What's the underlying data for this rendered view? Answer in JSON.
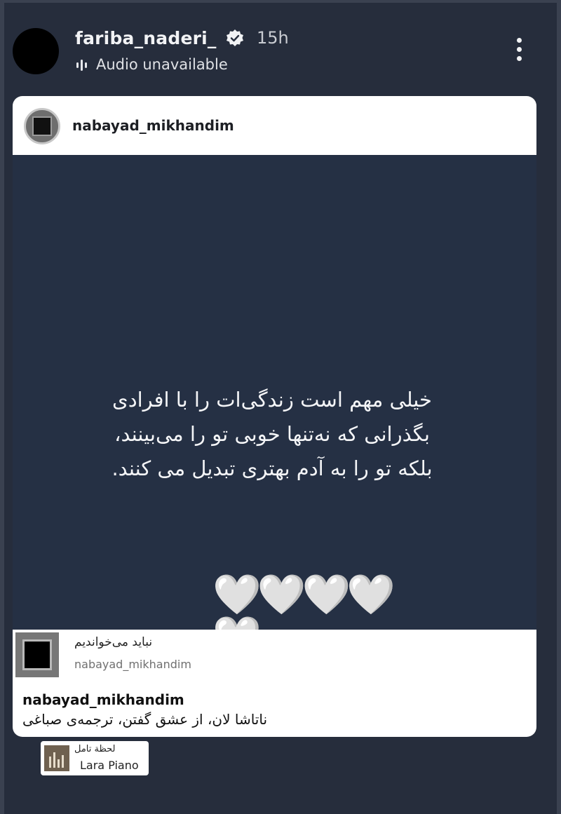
{
  "header": {
    "username": "fariba_naderi_",
    "time": "15h",
    "audio_status": "Audio unavailable",
    "verified_icon": "verified-badge-icon",
    "audio_icon": "audio-bars-icon",
    "more_icon": "more-vertical-icon"
  },
  "shared_post": {
    "username": "nabayad_mikhandim",
    "quote_lines": [
      "خیلی مهم است زندگی‌ات را با افرادی",
      "بگذرانی که نه‌تنها خوبی تو را می‌بینند،",
      "بلکه تو را به آدم بهتری تبدیل می کنند."
    ],
    "hearts": "🤍🤍🤍🤍🤍"
  },
  "profile_footer": {
    "name": "نباید می‌خواندیم",
    "handle": "nabayad_mikhandim",
    "caption_user": "nabayad_mikhandim",
    "caption_text": "ناتاشا لان، از عشق گفتن، ترجمه‌ی صباغی"
  },
  "music": {
    "title": "لحظة تامل",
    "artist": "Lara Piano"
  },
  "colors": {
    "background": "#262d3c",
    "card_body": "#253044",
    "card_white": "#ffffff"
  }
}
